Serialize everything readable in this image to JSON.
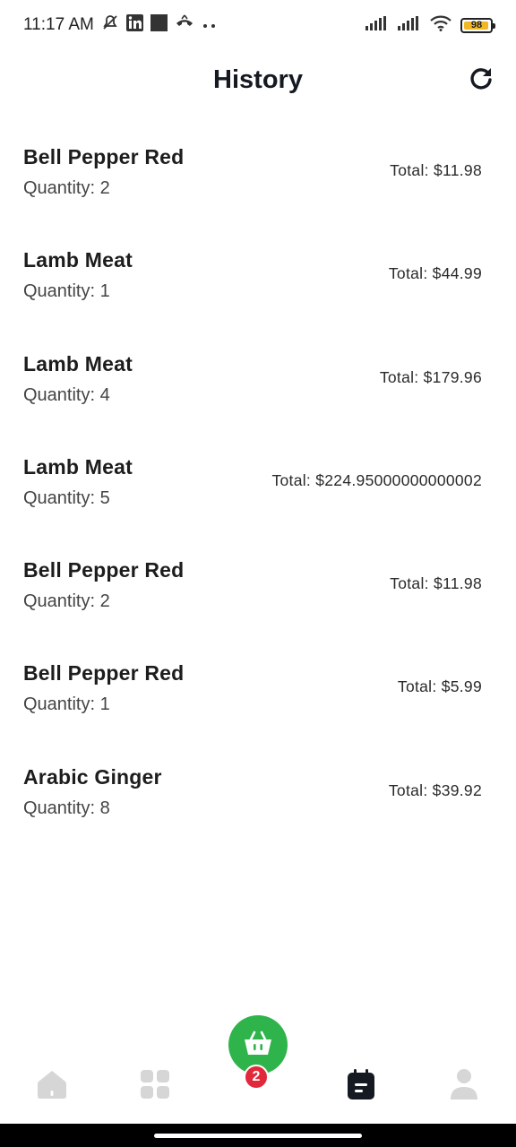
{
  "status_bar": {
    "time": "11:17 AM",
    "battery_level": "98",
    "icons": [
      "mute-icon",
      "linkedin-icon",
      "square-icon",
      "call-icon",
      "more-dots-icon",
      "signal-icon",
      "signal-icon",
      "wifi-icon",
      "battery-icon"
    ]
  },
  "header": {
    "title": "History",
    "refresh_icon": "refresh-icon"
  },
  "history": [
    {
      "name": "Bell Pepper Red",
      "quantity": "Quantity: 2",
      "total": "Total: $11.98"
    },
    {
      "name": "Lamb Meat",
      "quantity": "Quantity: 1",
      "total": "Total: $44.99"
    },
    {
      "name": "Lamb Meat",
      "quantity": "Quantity: 4",
      "total": "Total: $179.96"
    },
    {
      "name": "Lamb Meat",
      "quantity": "Quantity: 5",
      "total": "Total: $224.95000000000002"
    },
    {
      "name": "Bell Pepper Red",
      "quantity": "Quantity: 2",
      "total": "Total: $11.98"
    },
    {
      "name": "Bell Pepper Red",
      "quantity": "Quantity: 1",
      "total": "Total: $5.99"
    },
    {
      "name": "Arabic Ginger",
      "quantity": "Quantity: 8",
      "total": "Total: $39.92"
    }
  ],
  "bottom_nav": {
    "items": [
      "home-icon",
      "categories-icon",
      "cart-icon",
      "history-icon",
      "profile-icon"
    ],
    "active": "history-icon",
    "cart_badge": "2"
  },
  "colors": {
    "accent": "#2fb44b",
    "badge": "#e2293b",
    "inactive_icon": "#d6d6d6",
    "active_icon": "#151a22"
  }
}
